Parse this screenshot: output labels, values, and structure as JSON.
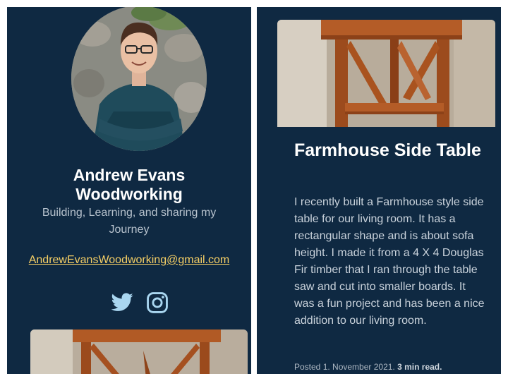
{
  "profile": {
    "name_line1": "Andrew Evans",
    "name_line2": "Woodworking",
    "tagline": "Building, Learning, and sharing my Journey",
    "email": "AndrewEvansWoodworking@gmail.com",
    "social": [
      {
        "icon": "twitter-icon",
        "color": "#a9d6f0"
      },
      {
        "icon": "instagram-icon",
        "color": "#a9d6f0"
      }
    ]
  },
  "post": {
    "title": "Farmhouse Side Table",
    "body": "I recently built a Farmhouse style side table for our living room. It has a rectangular shape and is about sofa height. I made it from a 4 X 4 Douglas Fir timber that I ran through the table saw and cut into smaller boards. It was a fun project and has been a nice addition to our living room.",
    "posted_label": "Posted 1. November 2021.",
    "read_time": "3 min read."
  },
  "colors": {
    "panel_bg": "#0f2942",
    "link": "#f6cf65",
    "heading": "#ffffff"
  }
}
